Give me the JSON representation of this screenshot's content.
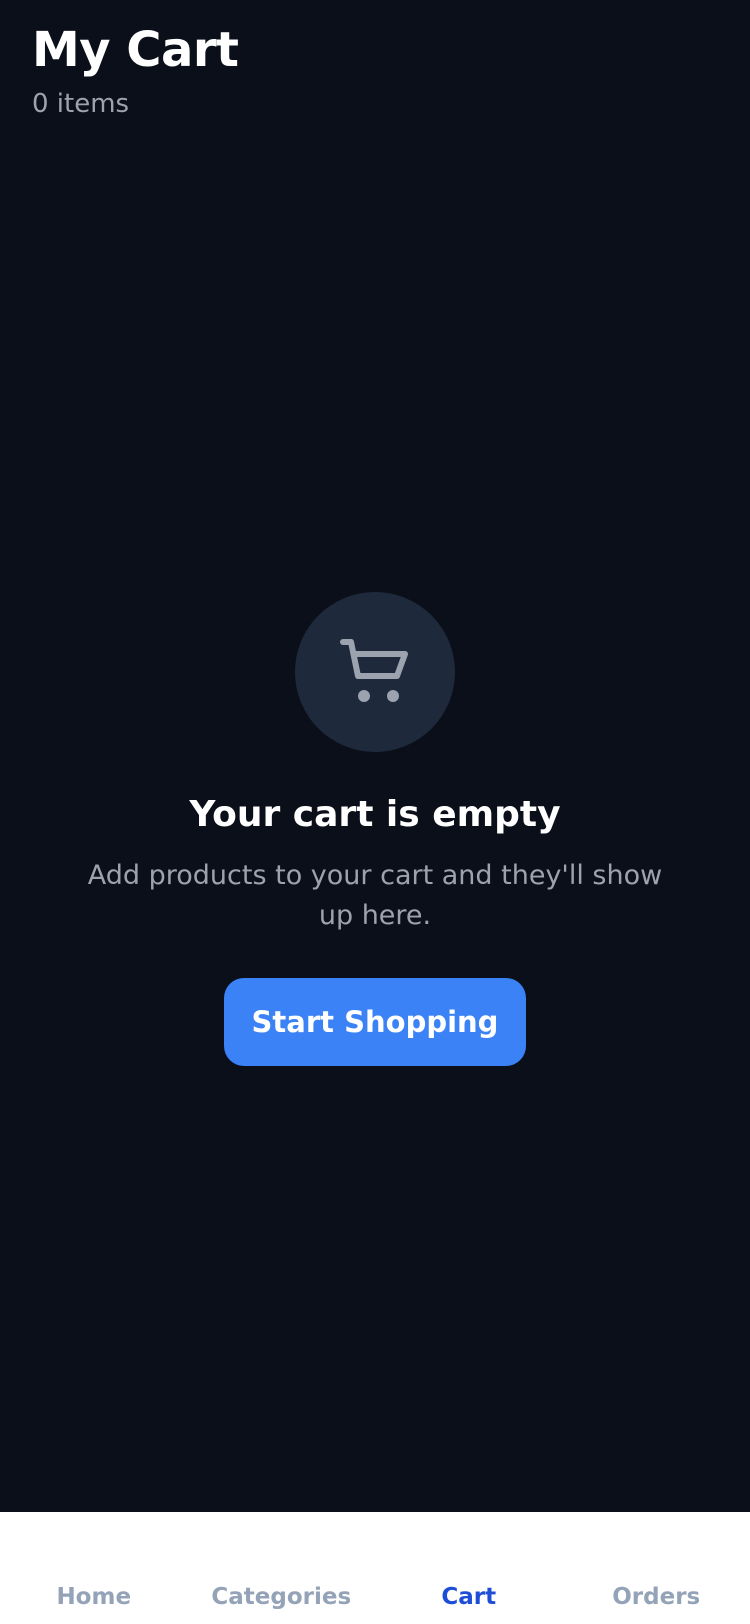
{
  "header": {
    "title": "My Cart",
    "item_count": "0 items"
  },
  "empty_state": {
    "icon": "shopping-cart-icon",
    "title": "Your cart is empty",
    "description": "Add products to your cart and they'll show up here.",
    "button_label": "Start Shopping"
  },
  "tabs": [
    {
      "label": "Home",
      "active": false
    },
    {
      "label": "Categories",
      "active": false
    },
    {
      "label": "Cart",
      "active": true
    },
    {
      "label": "Orders",
      "active": false
    }
  ],
  "colors": {
    "background": "#0b0f19",
    "icon_circle": "#1e293b",
    "accent": "#3b82f6",
    "active_tab": "#1d4ed8",
    "inactive_tab": "#94a3b8",
    "muted_text": "#9ca3af"
  }
}
